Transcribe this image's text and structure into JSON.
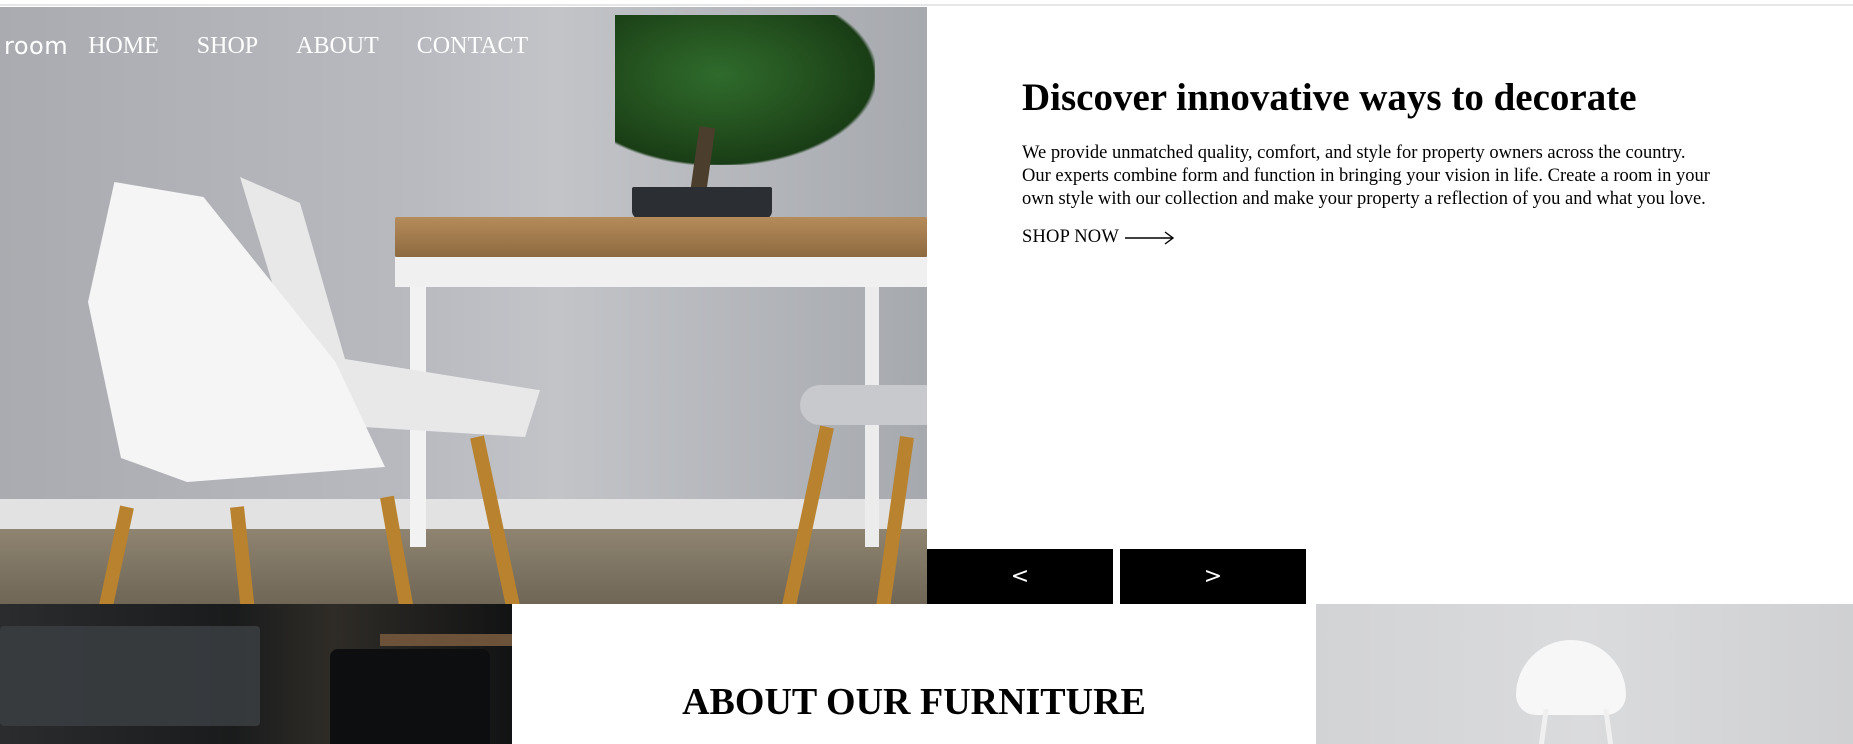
{
  "nav": {
    "logo": "room",
    "links": [
      "HOME",
      "SHOP",
      "ABOUT",
      "CONTACT"
    ]
  },
  "hero": {
    "title": "Discover innovative ways to decorate",
    "body": "We provide unmatched quality, comfort, and style for property owners across the country. Our experts combine form and function in bringing your vision in life. Create a room in your own style with our collection and make your property a reflection of you and what you love.",
    "cta": "SHOP NOW"
  },
  "slider": {
    "prev": "<",
    "next": ">"
  },
  "about": {
    "title": "ABOUT OUR FURNITURE"
  }
}
